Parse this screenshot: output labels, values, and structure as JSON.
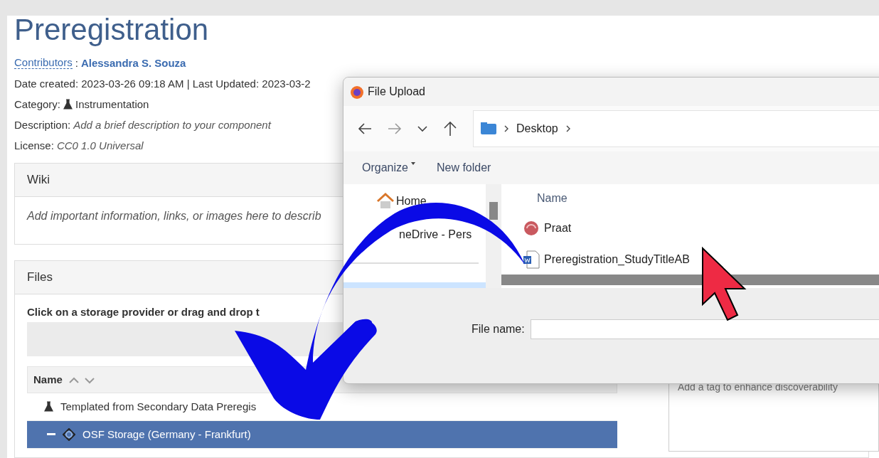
{
  "page": {
    "title": "Preregistration",
    "contributors_label": "Contributors",
    "separator": ":",
    "contributor": "Alessandra S. Souza",
    "date_line": "Date created: 2023-03-26 09:18 AM | Last Updated: 2023-03-2",
    "category_label": "Category:",
    "category": "Instrumentation",
    "description_label": "Description:",
    "description": "Add a brief description to your component",
    "license_label": "License:",
    "license": "CC0 1.0 Universal"
  },
  "wiki": {
    "title": "Wiki",
    "text": "Add important information, links, or images here to describ"
  },
  "files": {
    "title": "Files",
    "hint": "Click on a storage provider or drag and drop t",
    "column": "Name",
    "rows": [
      {
        "kind": "component",
        "label": "Templated from Secondary Data Preregis",
        "selected": false
      },
      {
        "kind": "storage",
        "label": "OSF Storage (Germany - Frankfurt)",
        "selected": true
      }
    ]
  },
  "tags": {
    "placeholder": "Add a tag to enhance discoverability"
  },
  "dialog": {
    "title": "File Upload",
    "breadcrumb": "Desktop",
    "toolbar": [
      {
        "label": "Organize",
        "kind": "menu"
      },
      {
        "label": "New folder",
        "kind": "plain"
      }
    ],
    "nav": [
      {
        "kind": "home",
        "label": "Home"
      },
      {
        "kind": "cloud",
        "label": "neDrive - Pers"
      }
    ],
    "column": "Name",
    "files": [
      {
        "kind": "app",
        "name": "Praat"
      },
      {
        "kind": "document",
        "name": "Preregistration_StudyTitleAB"
      }
    ],
    "file_name_label": "File name:"
  }
}
